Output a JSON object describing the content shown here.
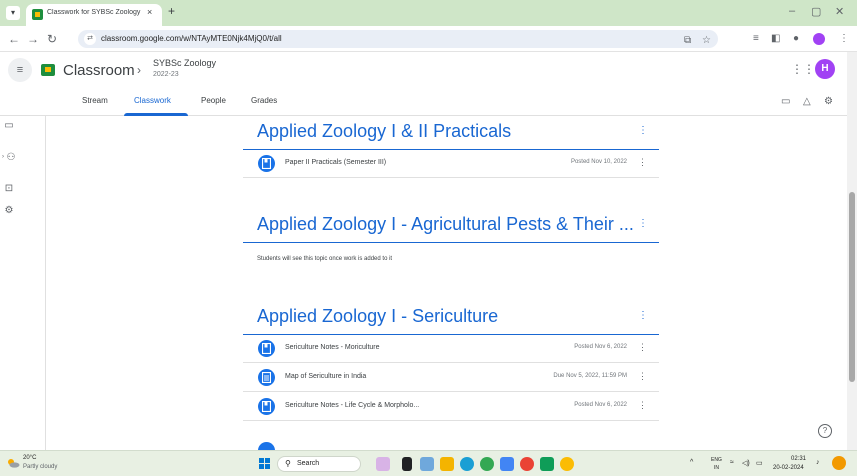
{
  "browser": {
    "tab_title": "Classwork for SYBSc Zoology 2",
    "url": "classroom.google.com/w/NTAyMTE0Njk4MjQ0/t/all",
    "new_tab_symbol": "+",
    "tab_close_symbol": "×"
  },
  "header": {
    "app_name": "Classroom",
    "class_name": "SYBSc Zoology",
    "class_section": "2022-23",
    "avatar_letter": "H"
  },
  "nav_tabs": [
    {
      "label": "Stream"
    },
    {
      "label": "Classwork"
    },
    {
      "label": "People"
    },
    {
      "label": "Grades"
    }
  ],
  "active_tab": "Classwork",
  "topics": [
    {
      "title": "Applied Zoology I & II Practicals",
      "items": [
        {
          "icon": "material-icon",
          "title": "Paper II Practicals (Semester III)",
          "meta": "Posted Nov 10, 2022"
        }
      ]
    },
    {
      "title": "Applied Zoology I - Agricultural Pests & Their ...",
      "empty_note": "Students will see this topic once work is added to it",
      "items": []
    },
    {
      "title": "Applied Zoology I - Sericulture",
      "items": [
        {
          "icon": "material-icon",
          "title": "Sericulture Notes - Moriculture",
          "meta": "Posted Nov 6, 2022"
        },
        {
          "icon": "assignment-icon",
          "title": "Map of Sericulture in India",
          "meta": "Due Nov 5, 2022, 11:59 PM"
        },
        {
          "icon": "material-icon",
          "title": "Sericulture Notes - Life Cycle & Morpholo...",
          "meta": "Posted Nov 6, 2022"
        }
      ]
    }
  ],
  "help_symbol": "?",
  "taskbar": {
    "weather_temp": "20°C",
    "weather_desc": "Partly cloudy",
    "search_placeholder": "Search",
    "lang_top": "ENG",
    "lang_bottom": "IN",
    "time": "02:31",
    "date": "20-02-2024"
  },
  "colors": {
    "accent": "#1967d2",
    "tabbar": "#cfe6c8",
    "taskbar": "#e8f0e3",
    "avatar": "#a142f4"
  }
}
